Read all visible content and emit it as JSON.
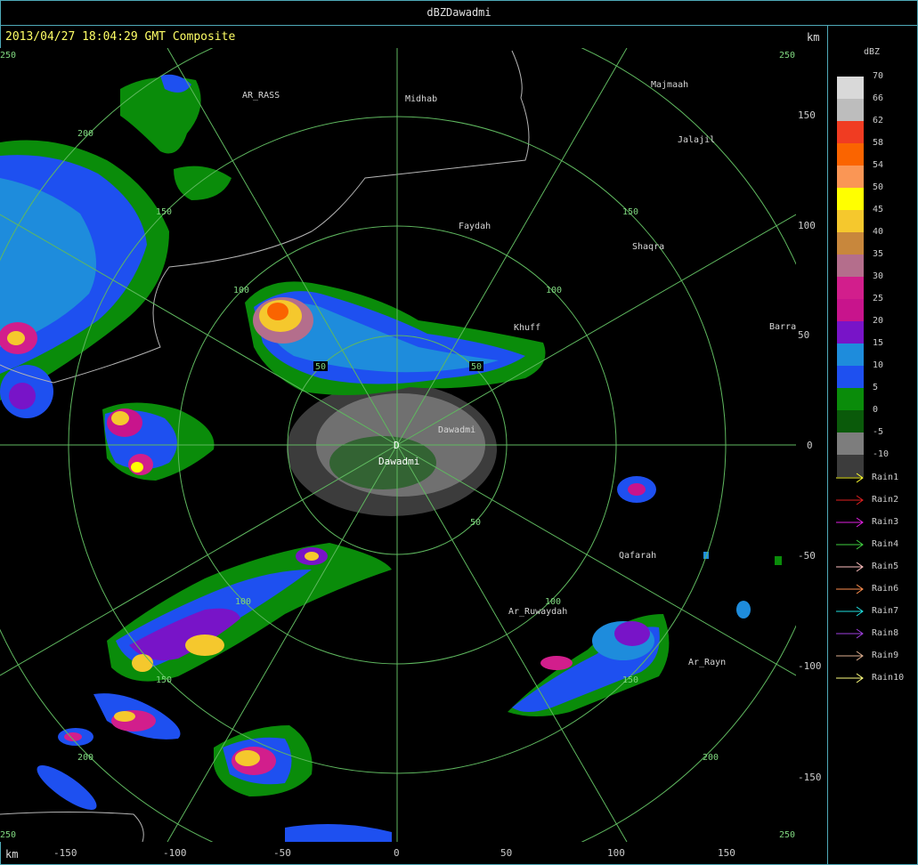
{
  "window": {
    "title": "dBZDawadmi"
  },
  "header": {
    "info": "2013/04/27 18:04:29 GMT Composite",
    "km_label": "km"
  },
  "axis": {
    "km_label": "km",
    "y_ticks": [
      "150",
      "100",
      "50",
      "0",
      "-50",
      "-100",
      "-150"
    ],
    "x_ticks": [
      "-150",
      "-100",
      "-50",
      "0",
      "50",
      "100",
      "150"
    ]
  },
  "radar": {
    "station_code": "D",
    "station_name": "Dawadmi",
    "rings": [
      "50",
      "100",
      "150",
      "200",
      "250"
    ],
    "places": [
      {
        "name": "AR_RASS"
      },
      {
        "name": "Midhab"
      },
      {
        "name": "Majmaah"
      },
      {
        "name": "Jalajil"
      },
      {
        "name": "Faydah"
      },
      {
        "name": "Shaqra"
      },
      {
        "name": "Khuff"
      },
      {
        "name": "Barra"
      },
      {
        "name": "Dawadmi"
      },
      {
        "name": "Qafarah"
      },
      {
        "name": "Ar_Ruwaydah"
      },
      {
        "name": "Ar_Rayn"
      }
    ]
  },
  "legend": {
    "unit": "dBZ",
    "levels": [
      {
        "label": "70",
        "color": "#d9d9d9"
      },
      {
        "label": "66",
        "color": "#bdbdbd"
      },
      {
        "label": "62",
        "color": "#f03c22"
      },
      {
        "label": "58",
        "color": "#fa6400"
      },
      {
        "label": "54",
        "color": "#fa9655"
      },
      {
        "label": "50",
        "color": "#ffff00"
      },
      {
        "label": "45",
        "color": "#f5c82d"
      },
      {
        "label": "40",
        "color": "#c8873c"
      },
      {
        "label": "35",
        "color": "#b46e8c"
      },
      {
        "label": "30",
        "color": "#d21e8c"
      },
      {
        "label": "25",
        "color": "#c8148c"
      },
      {
        "label": "20",
        "color": "#7814c8"
      },
      {
        "label": "15",
        "color": "#1e8cdc"
      },
      {
        "label": "10",
        "color": "#1e50f0"
      },
      {
        "label": "5",
        "color": "#0a8c0a"
      },
      {
        "label": "0",
        "color": "#0a5a0a"
      },
      {
        "label": "-5",
        "color": "#7d7d7d"
      },
      {
        "label": "-10",
        "color": "#3c3c3c"
      }
    ],
    "rain": [
      {
        "label": "Rain1",
        "color": "#ffff33"
      },
      {
        "label": "Rain2",
        "color": "#e02020"
      },
      {
        "label": "Rain3",
        "color": "#e020e0"
      },
      {
        "label": "Rain4",
        "color": "#40d040"
      },
      {
        "label": "Rain5",
        "color": "#ffc0c0"
      },
      {
        "label": "Rain6",
        "color": "#ff9050"
      },
      {
        "label": "Rain7",
        "color": "#20e0e0"
      },
      {
        "label": "Rain8",
        "color": "#a040e0"
      },
      {
        "label": "Rain9",
        "color": "#e0b090"
      },
      {
        "label": "Rain10",
        "color": "#ffff80"
      }
    ]
  }
}
